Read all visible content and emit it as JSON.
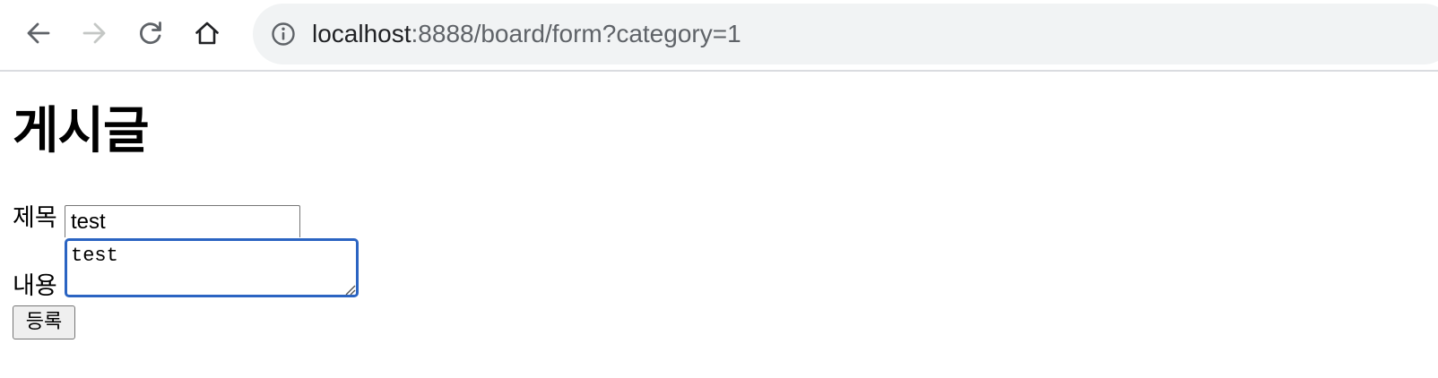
{
  "browser": {
    "icons": {
      "back": "arrow-left-icon",
      "forward": "arrow-right-icon",
      "reload": "reload-icon",
      "home": "home-icon",
      "site_info": "info-icon"
    },
    "forward_enabled": false,
    "url_host": "localhost",
    "url_path": ":8888/board/form?category=1"
  },
  "page": {
    "heading": "게시글",
    "form": {
      "title_label": "제목",
      "title_value": "test",
      "content_label": "내용",
      "content_value": "test",
      "submit_label": "등록"
    }
  },
  "colors": {
    "omnibox_bg": "#f1f3f4",
    "focus_ring": "#2b64c2",
    "icon_active": "#5f6368",
    "icon_disabled": "#c4c7c5"
  }
}
